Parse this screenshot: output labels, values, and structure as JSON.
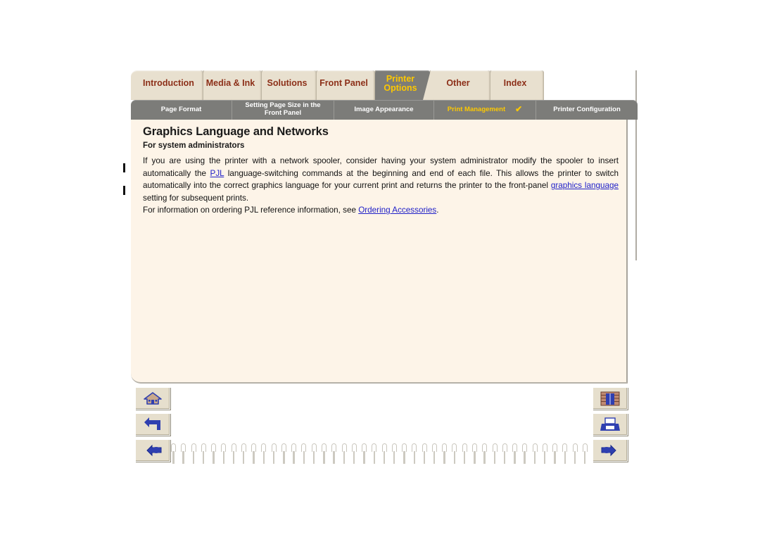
{
  "document": {
    "title": "Graphics Language and Networks",
    "subtitle": "For system administrators"
  },
  "main_tabs": [
    {
      "label": "Introduction",
      "active": false,
      "name": "tab-introduction"
    },
    {
      "label": "Media & Ink",
      "active": false,
      "name": "tab-media-and-ink"
    },
    {
      "label": "Solutions",
      "active": false,
      "name": "tab-solutions"
    },
    {
      "label": "Front Panel",
      "active": false,
      "name": "tab-front-panel"
    },
    {
      "label": "Printer\nOptions",
      "active": true,
      "name": "tab-printer-options"
    },
    {
      "label": "Other",
      "active": false,
      "name": "tab-other"
    },
    {
      "label": "Index",
      "active": false,
      "name": "tab-index"
    }
  ],
  "sub_nav": [
    {
      "label": "Page Format",
      "active": false,
      "check": "",
      "name": "subnav-page-format"
    },
    {
      "label": "Setting Page Size in the\nFront Panel",
      "active": false,
      "check": "",
      "name": "subnav-setting-page-size"
    },
    {
      "label": "Image Appearance",
      "active": false,
      "check": "",
      "name": "subnav-image-appearance"
    },
    {
      "label": "Print Management",
      "active": true,
      "check": "✔",
      "name": "subnav-print-management"
    },
    {
      "label": "Printer Configuration",
      "active": false,
      "check": "",
      "name": "subnav-printer-configuration"
    }
  ],
  "body": {
    "para1_part1": "If you are using the printer with a network spooler, consider having your system administrator modify the spooler to insert automatically the ",
    "link_pjl": "PJL",
    "para1_part2": " language-switching commands at the beginning and end of each file. This allows the printer to switch automatically into the correct graphics language for your current print and returns the printer to the front-panel ",
    "link_graphics_language": "graphics language",
    "para1_part3": " setting for subsequent prints.",
    "para2_part1": "For information on ordering PJL reference information, see ",
    "link_ordering_accessories": "Ordering Accessories",
    "para2_part2": "."
  },
  "nav_buttons_left": [
    {
      "icon": "home-icon",
      "name": "home-button"
    },
    {
      "icon": "back-arrow-icon",
      "name": "back-button"
    },
    {
      "icon": "hand-left-icon",
      "name": "previous-page-button"
    }
  ],
  "nav_buttons_right": [
    {
      "icon": "bookshelf-icon",
      "name": "library-button"
    },
    {
      "icon": "printer-icon",
      "name": "print-button"
    },
    {
      "icon": "hand-right-icon",
      "name": "next-page-button"
    }
  ],
  "colors": {
    "tab_inactive_bg": "#e8e0cf",
    "tab_inactive_text": "#8c2f18",
    "tab_active_bg": "#7c7c79",
    "tab_active_text": "#fdc800",
    "subnav_bg": "#7c7c79",
    "subnav_text": "#ffffff",
    "subnav_active_text": "#fdc800",
    "page_bg": "#fdf4e8",
    "link": "#2020c8",
    "icon_blue": "#2f3fb0"
  }
}
